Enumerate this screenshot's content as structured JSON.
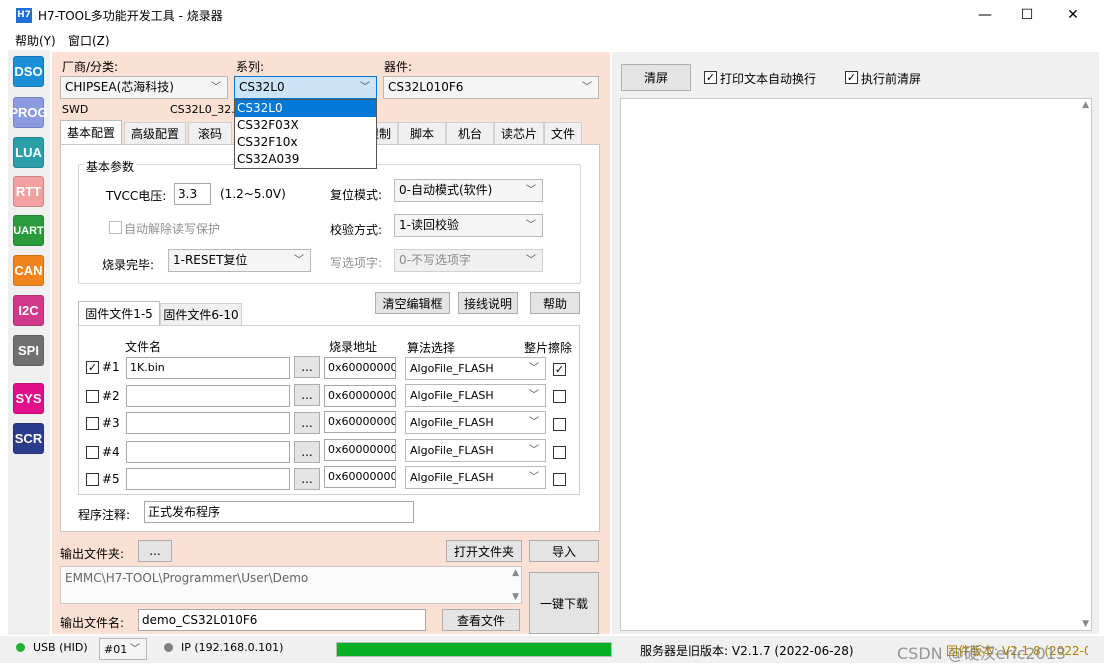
{
  "window": {
    "icon_label": "H7",
    "title": "H7-TOOL多功能开发工具 - 烧录器",
    "minimize": "—",
    "maximize": "☐",
    "close": "✕"
  },
  "menu": [
    "帮助(Y)",
    "窗口(Z)"
  ],
  "toolbar": [
    {
      "label": "DSO",
      "color": "#1a8fd6"
    },
    {
      "label": "PROG",
      "color": "#8a9be0"
    },
    {
      "label": "LUA",
      "color": "#2b9ea8"
    },
    {
      "label": "RTT",
      "color": "#f2a0a0"
    },
    {
      "label": "UART",
      "color": "#2a9a3a"
    },
    {
      "label": "CAN",
      "color": "#f0841e"
    },
    {
      "label": "I2C",
      "color": "#d0388a"
    },
    {
      "label": "SPI",
      "color": "#707070"
    },
    {
      "label": "SYS",
      "color": "#e0108a"
    },
    {
      "label": "SCR",
      "color": "#2c3c8c"
    }
  ],
  "selectors": {
    "vendor_label": "厂商/分类:",
    "vendor_value": "CHIPSEA(芯海科技)",
    "series_label": "系列:",
    "series_value": "CS32L0",
    "device_label": "器件:",
    "device_value": "CS32L010F6",
    "interface": "SWD",
    "algo_file": "CS32L0_32.lua"
  },
  "series_dropdown": [
    "CS32L0",
    "CS32F03X",
    "CS32F10x",
    "CS32A039"
  ],
  "tabs": [
    "基本配置",
    "高级配置",
    "滚码",
    "限制",
    "脚本",
    "机台",
    "读芯片",
    "文件"
  ],
  "basic": {
    "group_title": "基本参数",
    "tvcc_label": "TVCC电压:",
    "tvcc_value": "3.3",
    "tvcc_range": "(1.2~5.0V)",
    "reset_label": "复位模式:",
    "reset_value": "0-自动模式(软件)",
    "auto_unprotect": "自动解除读写保护",
    "verify_label": "校验方式:",
    "verify_value": "1-读回校验",
    "after_label": "烧录完毕:",
    "after_value": "1-RESET复位",
    "option_label": "写选项字:",
    "option_value": "0-不写选项字"
  },
  "buttons": {
    "clear_editor": "清空编辑框",
    "wiring": "接线说明",
    "help": "帮助",
    "browse": "...",
    "open_file": "打开文件夹",
    "import": "导入",
    "view_file": "查看文件",
    "one_key": "一键下载",
    "clear_screen": "清屏"
  },
  "file_tabs": [
    "固件文件1-5",
    "固件文件6-10"
  ],
  "file_table": {
    "headers": [
      "文件名",
      "烧录地址",
      "算法选择",
      "整片擦除"
    ],
    "rows": [
      {
        "id": "#1",
        "checked": true,
        "file": "1K.bin",
        "addr": "0x60000000",
        "algo": "AlgoFile_FLASH",
        "erase": true
      },
      {
        "id": "#2",
        "checked": false,
        "file": "",
        "addr": "0x60000000",
        "algo": "AlgoFile_FLASH",
        "erase": false
      },
      {
        "id": "#3",
        "checked": false,
        "file": "",
        "addr": "0x60000000",
        "algo": "AlgoFile_FLASH",
        "erase": false
      },
      {
        "id": "#4",
        "checked": false,
        "file": "",
        "addr": "0x60000000",
        "algo": "AlgoFile_FLASH",
        "erase": false
      },
      {
        "id": "#5",
        "checked": false,
        "file": "",
        "addr": "0x60000000",
        "algo": "AlgoFile_FLASH",
        "erase": false
      }
    ]
  },
  "comment": {
    "label": "程序注释:",
    "value": "正式发布程序"
  },
  "output": {
    "folder_label": "输出文件夹:",
    "path": "EMMC\\H7-TOOL\\Programmer\\User\\Demo",
    "name_label": "输出文件名:",
    "name_value": "demo_CS32L010F6"
  },
  "right": {
    "print_wrap": "打印文本自动换行",
    "clear_before": "执行前清屏"
  },
  "status": {
    "usb": "USB (HID)",
    "port": "#01",
    "ip": "IP (192.168.0.101)",
    "progress": 1.0,
    "server_version": "服务器是旧版本: V2.1.7 (2022-06-28)",
    "firmware_version": "固件版本: V2.1.8 (2022-06-27)",
    "watermark": "CSDN @硬汉eric2013"
  }
}
